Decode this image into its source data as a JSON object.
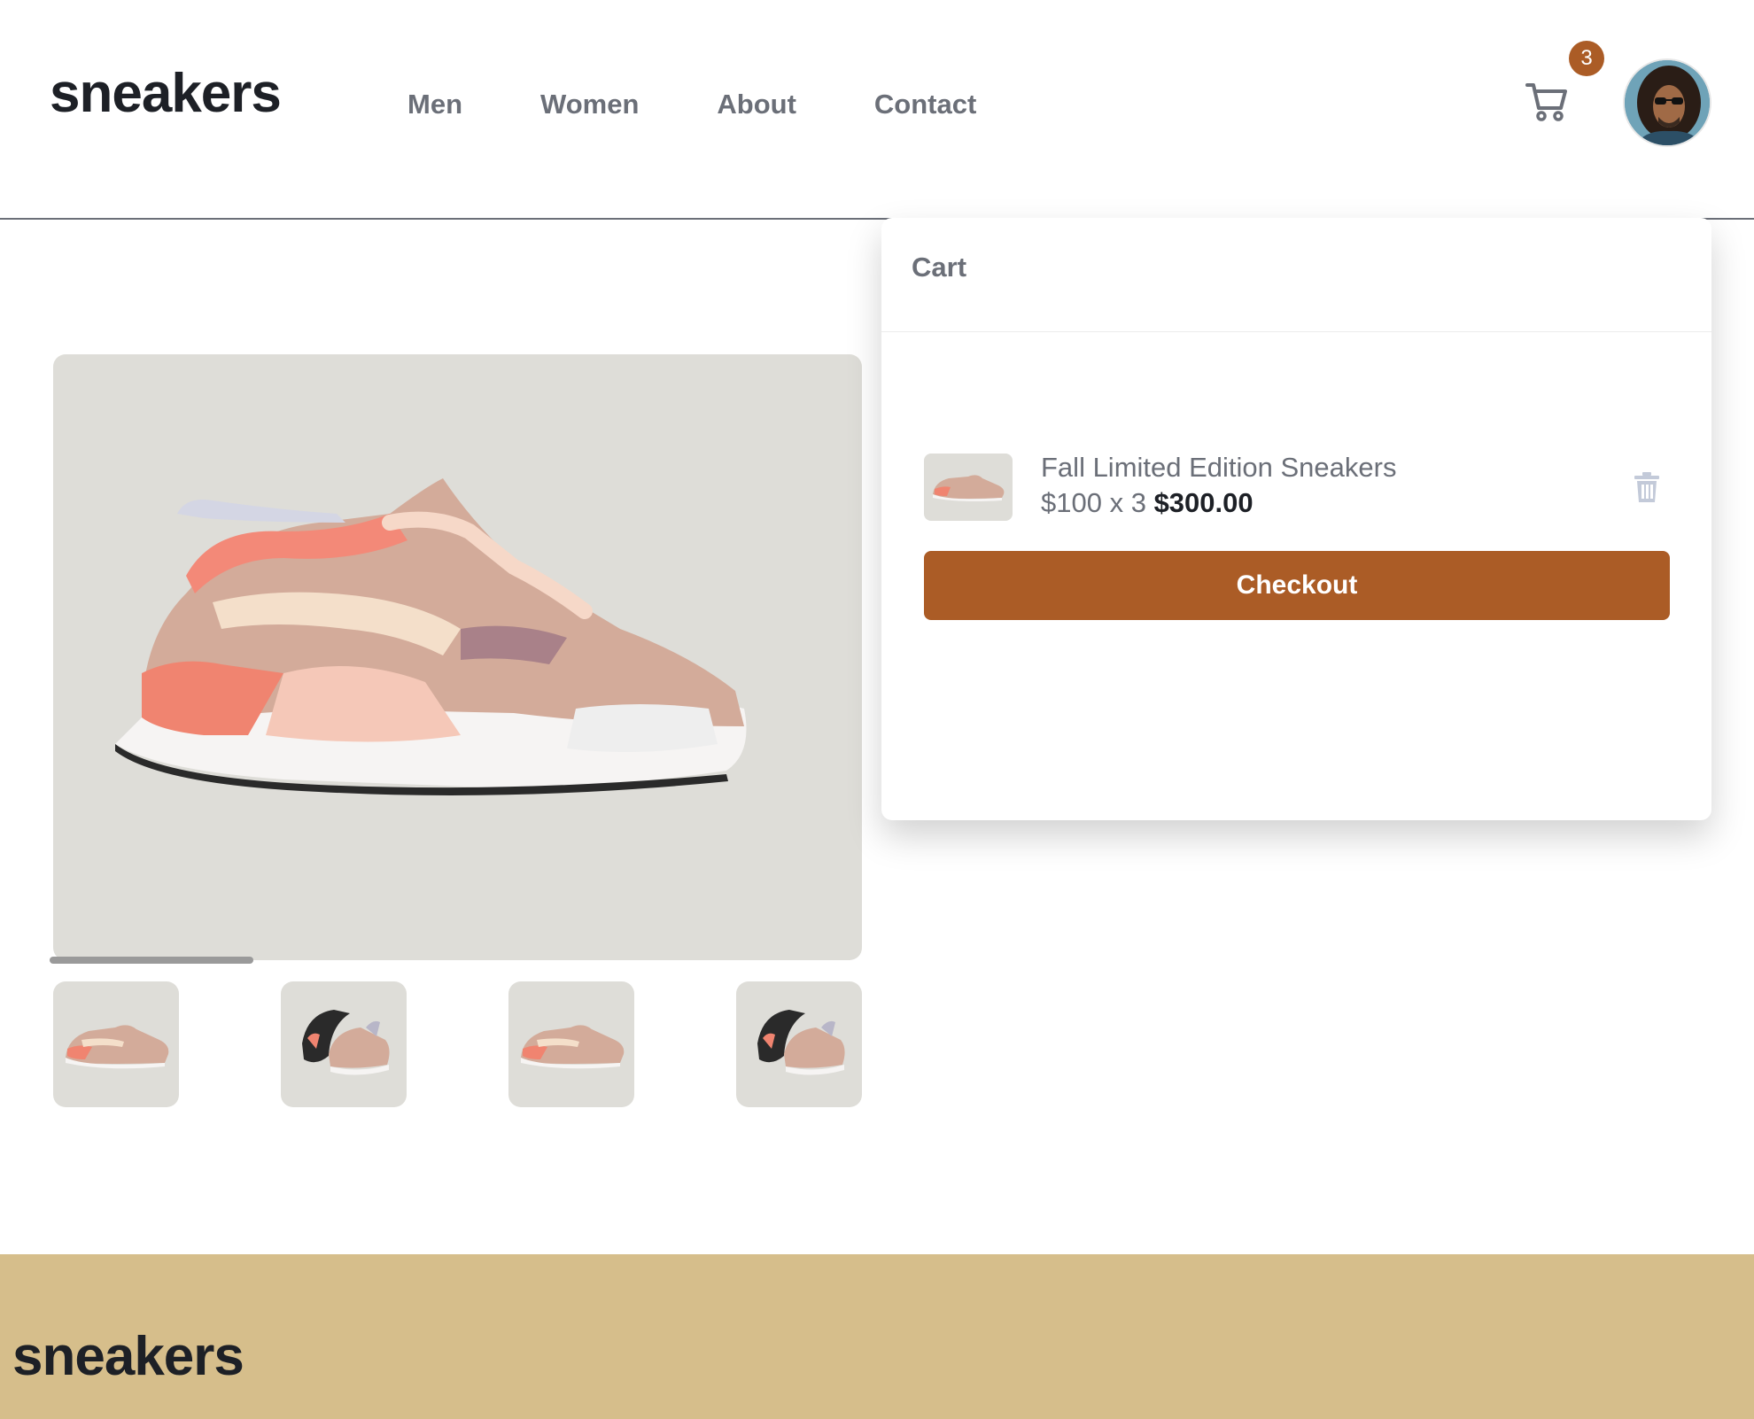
{
  "header": {
    "logo": "sneakers",
    "nav": [
      "Men",
      "Women",
      "About",
      "Contact"
    ],
    "cart_count": "3"
  },
  "cart": {
    "title": "Cart",
    "item": {
      "name": "Fall Limited Edition Sneakers",
      "unit_price_qty": "$100 x 3",
      "total": "$300.00"
    },
    "checkout_label": "Checkout"
  },
  "footer": {
    "logo": "sneakers"
  },
  "colors": {
    "accent": "#ab5c26",
    "footer_bg": "#d6be8b",
    "image_bg": "#deddd8",
    "text_dark": "#1d2026",
    "text_muted": "#6b6f78"
  }
}
